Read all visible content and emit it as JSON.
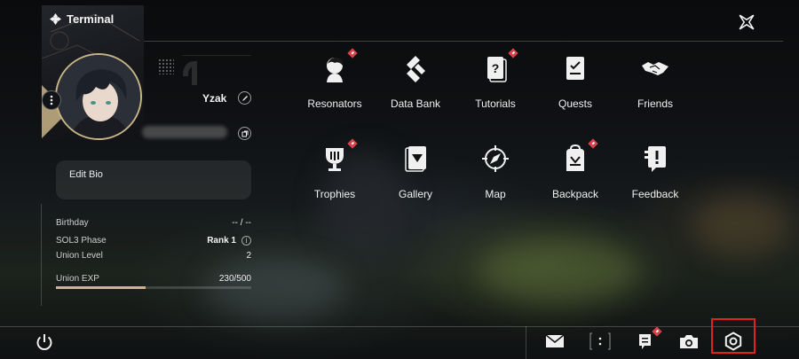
{
  "window": {
    "title": "Terminal"
  },
  "profile": {
    "name": "Yzak",
    "bio_button": "Edit Bio"
  },
  "stats": {
    "birthday_label": "Birthday",
    "birthday_value": "-- / --",
    "phase_label": "SOL3 Phase",
    "phase_value": "Rank 1",
    "union_level_label": "Union Level",
    "union_level_value": "2",
    "union_exp_label": "Union EXP",
    "union_exp_value": "230/500",
    "union_exp_fraction": 0.46
  },
  "menu": {
    "items": [
      {
        "label": "Resonators",
        "icon": "resonators-icon",
        "badge": true
      },
      {
        "label": "Data Bank",
        "icon": "data-bank-icon",
        "badge": false
      },
      {
        "label": "Tutorials",
        "icon": "tutorials-icon",
        "badge": true
      },
      {
        "label": "Quests",
        "icon": "quests-icon",
        "badge": false
      },
      {
        "label": "Friends",
        "icon": "friends-icon",
        "badge": false
      },
      {
        "label": "Trophies",
        "icon": "trophies-icon",
        "badge": true
      },
      {
        "label": "Gallery",
        "icon": "gallery-icon",
        "badge": false
      },
      {
        "label": "Map",
        "icon": "map-icon",
        "badge": false
      },
      {
        "label": "Backpack",
        "icon": "backpack-icon",
        "badge": true
      },
      {
        "label": "Feedback",
        "icon": "feedback-icon",
        "badge": false
      }
    ]
  },
  "bottom_bar": {
    "icons": [
      "power-icon",
      "mail-icon",
      "more-icon",
      "notice-icon",
      "camera-icon",
      "settings-icon"
    ],
    "notice_badge": true,
    "highlighted": "settings-icon"
  },
  "colors": {
    "accent_gold": "#c9b58e",
    "badge_red": "#d8434b",
    "highlight_red": "#e2231a"
  }
}
